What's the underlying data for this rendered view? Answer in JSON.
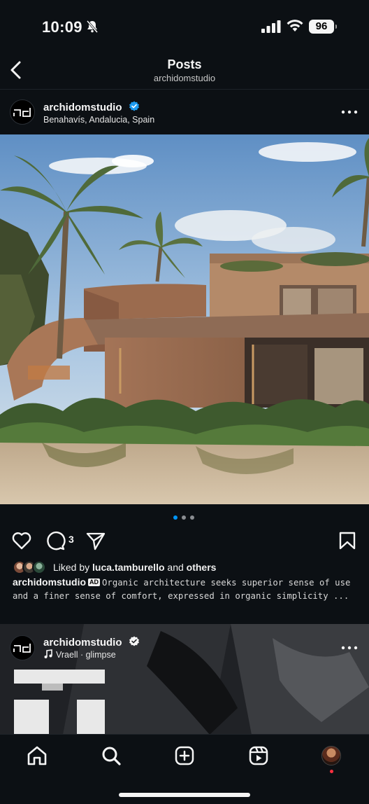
{
  "status_bar": {
    "time": "10:09",
    "battery": "96"
  },
  "header": {
    "title": "Posts",
    "subtitle": "archidomstudio"
  },
  "post": {
    "username": "archidomstudio",
    "location": "Benahavís, Andalucia, Spain",
    "comment_count": "3",
    "liked_by_prefix": "Liked by",
    "liked_by_user": "luca.tamburello",
    "liked_by_and": "and",
    "liked_by_others": "others",
    "caption_user": "archidomstudio",
    "caption_badge": "AD",
    "caption_text": "Organic architecture seeks superior sense of use and a finer sense of comfort, expressed in organic simplicity ...",
    "carousel_count": 3,
    "carousel_active": 0
  },
  "next_post": {
    "username": "archidomstudio",
    "audio": "Vraell · glimpse"
  },
  "colors": {
    "background": "#0c1014",
    "accent_blue": "#0095f6",
    "verified_blue": "#1d9bf0",
    "notification_red": "#ff3040"
  },
  "icons": {
    "back": "chevron-left-icon",
    "like": "heart-icon",
    "comment": "comment-bubble-icon",
    "share": "paper-plane-icon",
    "save": "bookmark-icon",
    "home": "home-icon",
    "search": "search-icon",
    "create": "plus-square-icon",
    "reels": "reels-icon"
  }
}
